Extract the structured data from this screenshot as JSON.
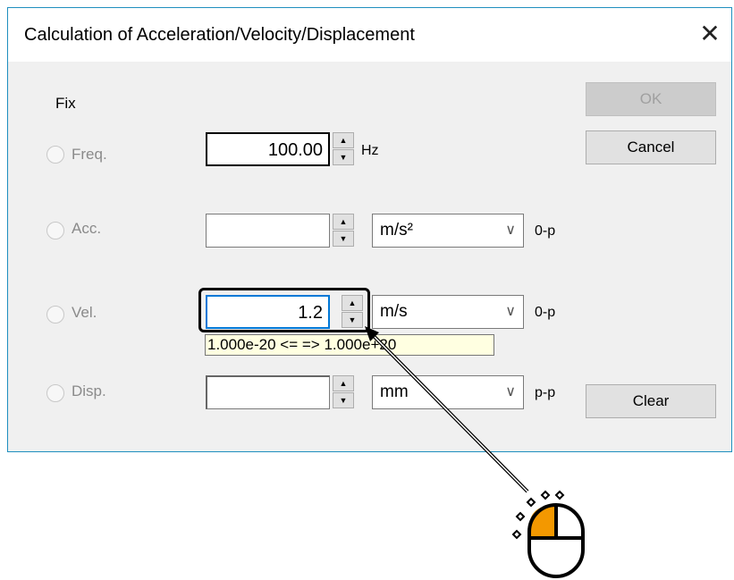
{
  "dialog": {
    "title": "Calculation of Acceleration/Velocity/Displacement",
    "close_glyph": "✕"
  },
  "fix_label": "Fix",
  "rows": {
    "freq": {
      "label": "Freq.",
      "value": "100.00",
      "unit": "Hz"
    },
    "acc": {
      "label": "Acc.",
      "value": "",
      "unit_select": "m/s²",
      "mode": "0-p"
    },
    "vel": {
      "label": "Vel.",
      "value": "1.2",
      "unit_select": "m/s",
      "mode": "0-p",
      "tooltip": "1.000e-20 <= => 1.000e+20"
    },
    "disp": {
      "label": "Disp.",
      "value": "",
      "unit_select": "mm",
      "mode": "p-p"
    }
  },
  "buttons": {
    "ok": "OK",
    "cancel": "Cancel",
    "clear": "Clear"
  },
  "spin": {
    "up": "▲",
    "down": "▼"
  },
  "combo_arrow": "∨",
  "colors": {
    "accent": "#1f8fbf",
    "mouse_button": "#f39800",
    "tooltip_bg": "#ffffe1"
  }
}
